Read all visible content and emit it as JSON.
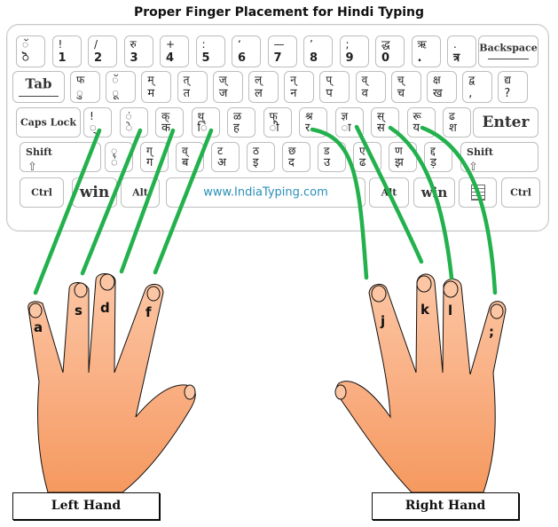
{
  "title": "Proper Finger Placement for Hindi Typing",
  "keyboard": {
    "row1": [
      {
        "top": "ॅ",
        "bot": "ॆ"
      },
      {
        "top": "!",
        "bot": "1"
      },
      {
        "top": "/",
        "bot": "2"
      },
      {
        "top": "रु",
        "bot": "3"
      },
      {
        "top": "+",
        "bot": "4"
      },
      {
        "top": ":",
        "bot": "5"
      },
      {
        "top": "‘",
        "bot": "6"
      },
      {
        "top": "—",
        "bot": "7"
      },
      {
        "top": "’",
        "bot": "8"
      },
      {
        "top": ";",
        "bot": "9"
      },
      {
        "top": "द्ध",
        "bot": "0"
      },
      {
        "top": "ऋ",
        "bot": "."
      },
      {
        "top": ".",
        "bot": "त्र"
      }
    ],
    "backspace": "Backspace",
    "tab": "Tab",
    "row2": [
      {
        "top": "फ",
        "bot": "ु"
      },
      {
        "top": "ॅ",
        "bot": "ू"
      },
      {
        "top": "म्",
        "bot": "म"
      },
      {
        "top": "त्",
        "bot": "त"
      },
      {
        "top": "ज्",
        "bot": "ज"
      },
      {
        "top": "ल्",
        "bot": "ल"
      },
      {
        "top": "न्",
        "bot": "न"
      },
      {
        "top": "प्",
        "bot": "प"
      },
      {
        "top": "व्",
        "bot": "व"
      },
      {
        "top": "च्",
        "bot": "च"
      },
      {
        "top": "क्ष",
        "bot": "ख"
      },
      {
        "top": "द्व",
        "bot": ","
      },
      {
        "top": "द्य",
        "bot": "?"
      }
    ],
    "caps_lock": "Caps Lock",
    "row3": [
      {
        "top": "!",
        "bot": "्"
      },
      {
        "top": "ं",
        "bot": "े"
      },
      {
        "top": "क्",
        "bot": "क"
      },
      {
        "top": "थ्",
        "bot": "ि"
      },
      {
        "top": "ळ",
        "bot": "ह"
      },
      {
        "top": "फ्",
        "bot": "ी"
      },
      {
        "top": "श्र",
        "bot": "र"
      },
      {
        "top": "ज्ञ",
        "bot": "ा"
      },
      {
        "top": "स्",
        "bot": "स"
      },
      {
        "top": "रू",
        "bot": "य"
      },
      {
        "top": "ढ",
        "bot": "श"
      }
    ],
    "enter": "Enter",
    "shift_left": "Shift",
    "row4": [
      {
        "top": "ृ",
        "bot": "ं"
      },
      {
        "top": "ग्",
        "bot": "ग"
      },
      {
        "top": "व्",
        "bot": "ब"
      },
      {
        "top": "ट",
        "bot": "अ"
      },
      {
        "top": "ठ",
        "bot": "इ"
      },
      {
        "top": "छ",
        "bot": "द"
      },
      {
        "top": "ड",
        "bot": "उ"
      },
      {
        "top": "ए",
        "bot": "ढ"
      },
      {
        "top": "ण",
        "bot": "झ"
      },
      {
        "top": "द्द",
        "bot": "ड़"
      }
    ],
    "shift_right": "Shift",
    "ctrl_left": "Ctrl",
    "win_left": "win",
    "alt_left": "Alt",
    "space_text": "www.IndiaTyping.com",
    "alt_right": "Alt",
    "win_right": "win",
    "ctrl_right": "Ctrl"
  },
  "hands": {
    "left": {
      "caption": "Left Hand",
      "fingers": [
        "a",
        "s",
        "d",
        "f"
      ]
    },
    "right": {
      "caption": "Right Hand",
      "fingers": [
        "j",
        "k",
        "l",
        ";"
      ]
    }
  },
  "colors": {
    "guide_line": "#22b14c",
    "skin_light": "#fbc3a0",
    "skin_dark": "#f5a070",
    "site_text": "#2a8fb8"
  }
}
